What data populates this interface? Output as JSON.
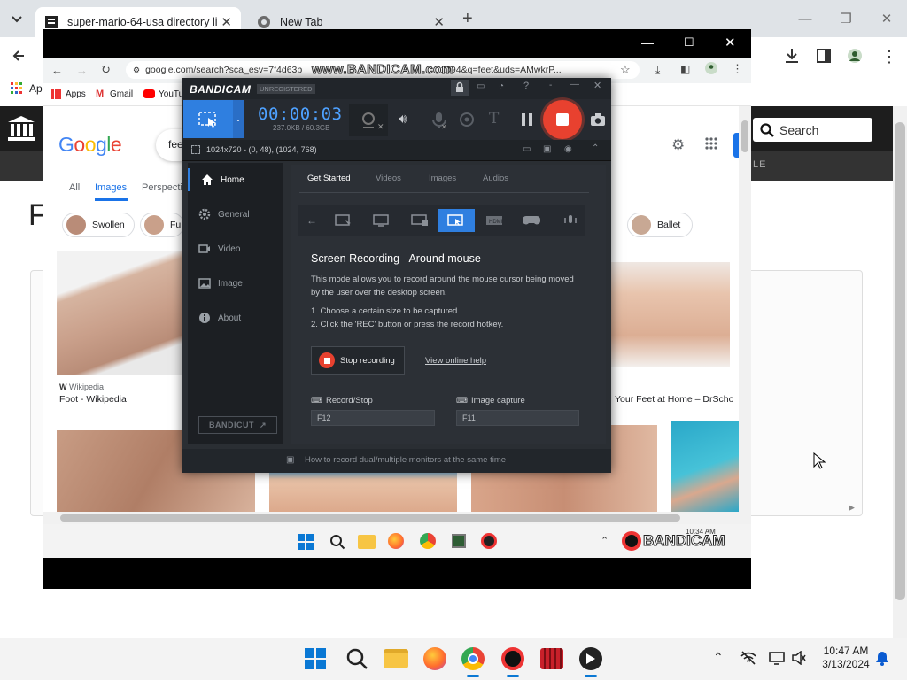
{
  "outer_browser": {
    "tabs": [
      {
        "title": "super-mario-64-usa directory li"
      },
      {
        "title": "New Tab"
      }
    ],
    "new_tab": "+",
    "bookmarks_apps": "Ap"
  },
  "background_site": {
    "search_placeholder": "Search",
    "nav_text": "LE",
    "heading_letter": "F"
  },
  "inner_browser": {
    "address": "google.com/search?sca_esv=7f4d63b",
    "address_tail": "1094&q=feet&uds=AMwkrP...",
    "watermark": "www.BANDICAM.com",
    "bookmarks": [
      {
        "label": "Apps"
      },
      {
        "label": "Gmail"
      },
      {
        "label": "YouTu"
      }
    ],
    "google": {
      "logo": "Google",
      "query": "fee",
      "tabs": [
        "All",
        "Images",
        "Perspecti"
      ],
      "chips": [
        "Swollen",
        "Fu",
        "Ballet"
      ],
      "results": [
        {
          "source": "Wikipedia",
          "title": "Foot - Wikipedia"
        },
        {
          "title": "Your Feet at Home – DrScho"
        }
      ]
    },
    "taskbar_badge": "BANDICAM",
    "taskbar_time": "10:34 AM"
  },
  "bandicam": {
    "brand": "BANDICAM",
    "registration": "UNREGISTERED",
    "timer": "00:00:03",
    "size": "237.0KB / 60.3GB",
    "region": "1024x720 - (0, 48), (1024, 768)",
    "sidebar": [
      {
        "label": "Home",
        "active": true
      },
      {
        "label": "General"
      },
      {
        "label": "Video"
      },
      {
        "label": "Image"
      },
      {
        "label": "About"
      }
    ],
    "bandicut": "BANDICUT",
    "tabs": [
      "Get Started",
      "Videos",
      "Images",
      "Audios"
    ],
    "mode_title": "Screen Recording - Around mouse",
    "mode_desc_1": "This mode allows you to record around the mouse cursor being moved",
    "mode_desc_2": "by the user over the desktop screen.",
    "step_1": "1. Choose a certain size to be captured.",
    "step_2": "2. Click the 'REC' button or press the record hotkey.",
    "stop_button": "Stop recording",
    "help_link": "View online help",
    "record_stop_label": "Record/Stop",
    "record_stop_key": "F12",
    "image_capture_label": "Image capture",
    "image_capture_key": "F11",
    "footer_tip": "How to record dual/multiple monitors at the same time",
    "colors": {
      "accent": "#2f7fe0",
      "record": "#e8412f"
    }
  },
  "taskbar": {
    "time": "10:47 AM",
    "date": "3/13/2024"
  }
}
